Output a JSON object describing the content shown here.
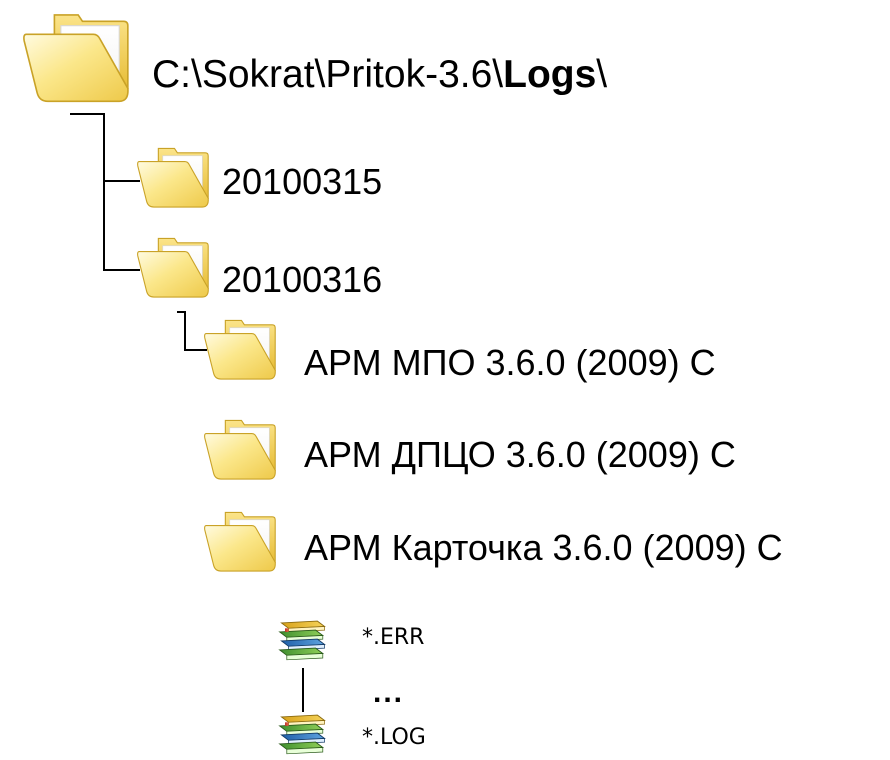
{
  "root": {
    "path_prefix": "C:\\Sokrat\\Pritok-3.6\\",
    "path_bold": "Logs",
    "path_suffix": "\\",
    "icon": "folder-icon"
  },
  "folders_level1": [
    {
      "label": "20100315",
      "icon": "folder-icon"
    },
    {
      "label": "20100316",
      "icon": "folder-icon"
    }
  ],
  "folders_level2": [
    {
      "label": "АРМ МПО 3.6.0 (2009) С",
      "icon": "folder-icon"
    },
    {
      "label": "АРМ ДПЦО 3.6.0 (2009) С",
      "icon": "folder-icon"
    },
    {
      "label": "АРМ Карточка 3.6.0 (2009) С",
      "icon": "folder-icon"
    }
  ],
  "files": [
    {
      "label": "*.ERR",
      "icon": "books-icon"
    },
    {
      "label": "*.LOG",
      "icon": "books-icon"
    }
  ],
  "ellipsis": "...",
  "colors": {
    "folder_light": "#fff4b0",
    "folder_mid": "#f7d95c",
    "folder_dark": "#e2b72a",
    "folder_edge": "#c9a227",
    "connector": "#000000"
  }
}
